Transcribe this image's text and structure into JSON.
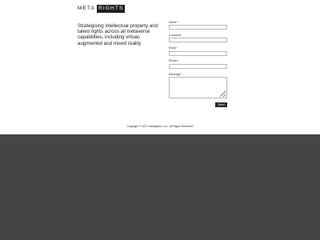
{
  "logo": {
    "meta": "META",
    "rights": "RIGHTS"
  },
  "tagline": "Strategising intellectual property and talent rights across all metaverse capabilities, including virtual, augmented and mixed reality",
  "form": {
    "name_label": "Name *",
    "company_label": "Company",
    "email_label": "Email *",
    "phone_label": "Phone *",
    "message_label": "Message *",
    "send_label": "Send"
  },
  "footer": {
    "copyright": "Copyright © 2021 metarights, LLC. All Rights Reserved"
  }
}
